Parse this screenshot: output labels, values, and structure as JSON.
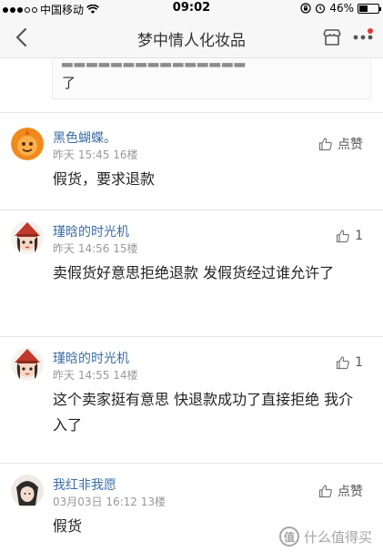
{
  "status_bar": {
    "carrier": "中国移动",
    "time": "09:02",
    "battery": "46%",
    "battery_level": 0.46
  },
  "nav": {
    "title": "梦中情人化妆品"
  },
  "quote": {
    "tail_text": "了"
  },
  "comments": [
    {
      "user": "黑色蝴蝶。",
      "meta": "昨天 15:45 16楼",
      "like_label": "点赞",
      "text": "假货，要求退款",
      "avatar_color": "#f08a1c"
    },
    {
      "user": "瑾晗的时光机",
      "meta": "昨天 14:56 15楼",
      "like_label": "1",
      "text": "卖假货好意思拒绝退款 发假货经过谁允许了",
      "avatar_color": "#c0392b"
    },
    {
      "user": "瑾晗的时光机",
      "meta": "昨天 14:55 14楼",
      "like_label": "1",
      "text": "这个卖家挺有意思 快退款成功了直接拒绝 我介入了",
      "avatar_color": "#c0392b"
    },
    {
      "user": "我红非我愿",
      "meta": "03月03日 16:12 13楼",
      "like_label": "点赞",
      "text": "假货",
      "avatar_color": "#2b2b2b"
    }
  ],
  "watermark": {
    "logo": "值",
    "text": "什么值得买"
  },
  "colors": {
    "link": "#3b6ea5",
    "meta": "#999999",
    "badge": "#e03c3c"
  }
}
